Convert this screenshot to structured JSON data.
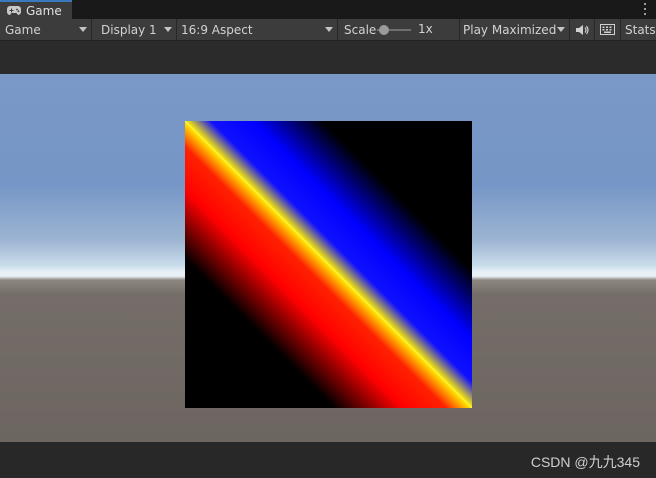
{
  "tab": {
    "title": "Game",
    "icon": "gamepad-icon"
  },
  "toolbar": {
    "mode": "Game",
    "display": "Display 1",
    "aspect": "16:9 Aspect",
    "scale_label": "Scale",
    "scale_value": "1x",
    "scale_fraction": 0.1,
    "play_mode": "Play Maximized",
    "mute_icon": "speaker-icon",
    "keyboard_icon": "keyboard-icon",
    "stats": "Stats"
  },
  "viewport": {
    "colors": {
      "red": "#ff0000",
      "yellow": "#ffee00",
      "blue": "#0000ff",
      "black": "#000000"
    }
  },
  "watermark": "CSDN @九九345"
}
